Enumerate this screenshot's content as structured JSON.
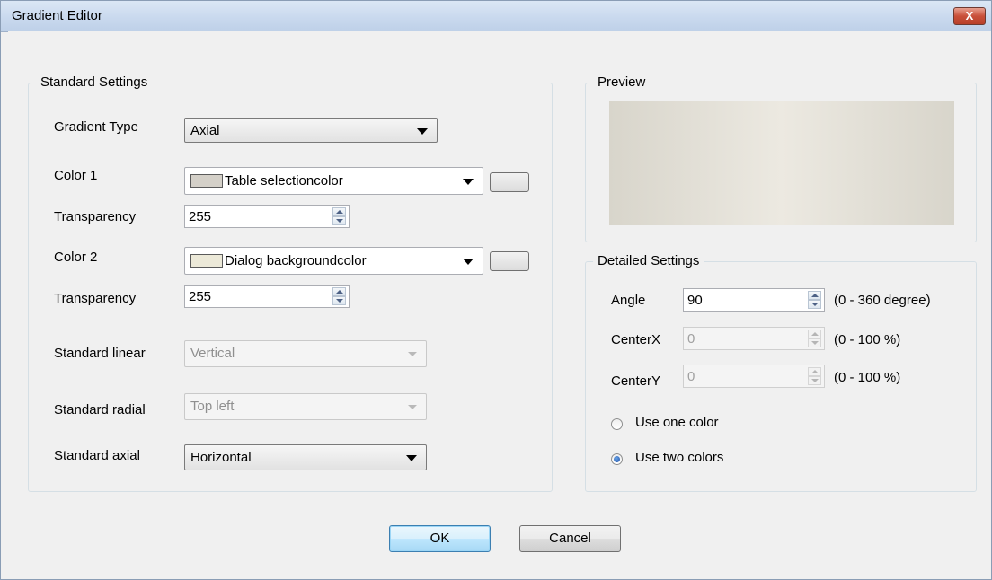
{
  "window": {
    "title": "Gradient Editor",
    "close_label": "X"
  },
  "standard": {
    "group_label": "Standard Settings",
    "gradient_type_label": "Gradient Type",
    "gradient_type_value": "Axial",
    "color1_label": "Color 1",
    "color1_value": "Table selectioncolor",
    "color1_swatch": "#d4d0c8",
    "transparency1_label": "Transparency",
    "transparency1_value": "255",
    "color2_label": "Color 2",
    "color2_value": "Dialog backgroundcolor",
    "color2_swatch": "#ece9d8",
    "transparency2_label": "Transparency",
    "transparency2_value": "255",
    "linear_label": "Standard linear",
    "linear_value": "Vertical",
    "radial_label": "Standard radial",
    "radial_value": "Top left",
    "axial_label": "Standard axial",
    "axial_value": "Horizontal"
  },
  "preview": {
    "group_label": "Preview"
  },
  "detailed": {
    "group_label": "Detailed Settings",
    "angle_label": "Angle",
    "angle_value": "90",
    "angle_range": "(0 - 360 degree)",
    "centerx_label": "CenterX",
    "centerx_value": "0",
    "centerx_range": "(0 - 100 %)",
    "centery_label": "CenterY",
    "centery_value": "0",
    "centery_range": "(0 - 100 %)",
    "radio_one": "Use one color",
    "radio_two": "Use two colors",
    "selected_radio": "Use two colors"
  },
  "buttons": {
    "ok": "OK",
    "cancel": "Cancel"
  }
}
